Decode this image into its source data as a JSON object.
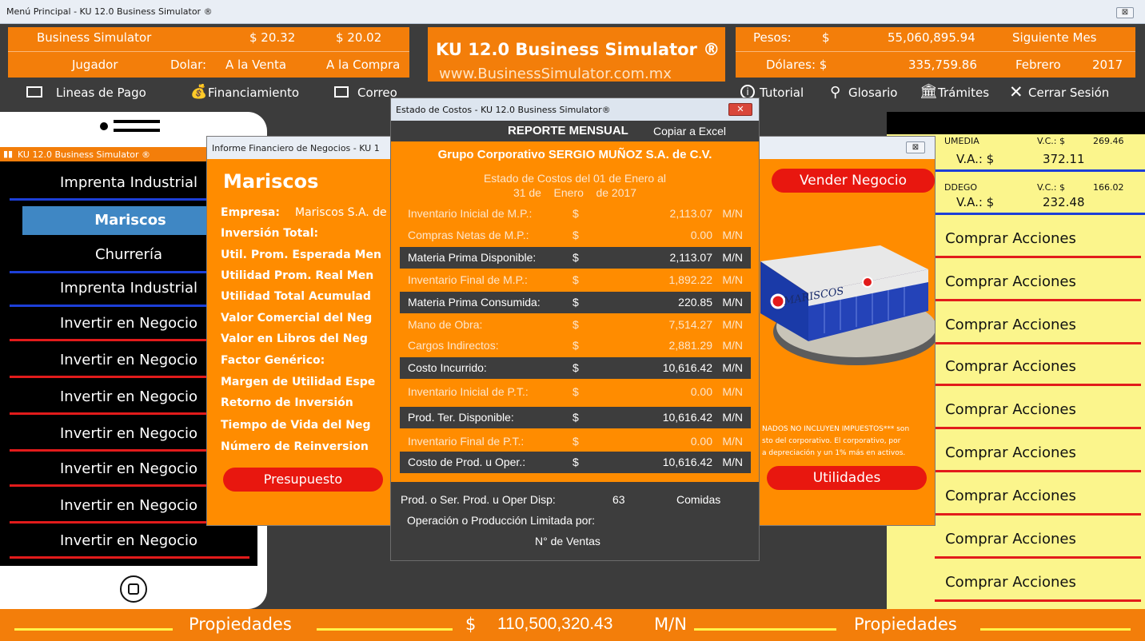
{
  "window": {
    "title": "Menú Principal - KU 12.0 Business Simulator ®",
    "close": "⊠"
  },
  "header": {
    "business_simulator": "Business Simulator",
    "price1": "$ 20.32",
    "price2": "$ 20.02",
    "jugador": "Jugador",
    "dolar": "Dolar:",
    "a_la_venta": "A la Venta",
    "a_la_compra": "A la Compra",
    "brand_title": "KU 12.0 Business Simulator ®",
    "brand_url": "www.BusinessSimulator.com.mx",
    "pesos_label": "Pesos:",
    "pesos_cur": "$",
    "pesos_value": "55,060,895.94",
    "siguiente_mes": "Siguiente Mes",
    "dolares_label": "Dólares: $",
    "dolares_value": "335,759.86",
    "month": "Febrero",
    "year": "2017"
  },
  "toolbar": {
    "lineas": "Lineas de Pago",
    "financiamiento": "Financiamiento",
    "correo": "Correo",
    "tutorial": "Tutorial",
    "glosario": "Glosario",
    "tramites": "Trámites",
    "cerrar": "Cerrar Sesión"
  },
  "phone": {
    "status": "KU 12.0 Business Simulator ®",
    "items": [
      "Imprenta Industrial",
      "Mariscos",
      "Churrería",
      "Imprenta Industrial",
      "Invertir en Negocio",
      "Invertir en Negocio",
      "Invertir en Negocio",
      "Invertir en Negocio",
      "Invertir en Negocio",
      "Invertir en Negocio",
      "Invertir en Negocio"
    ]
  },
  "right": {
    "r1_name": "UMEDIA",
    "r1_vc_label": "V.C.: $",
    "r1_vc": "269.46",
    "r1_va_label": "V.A.: $",
    "r1_va": "372.11",
    "r2_name": "DDEGO",
    "r2_vc_label": "V.C.: $",
    "r2_vc": "166.02",
    "r2_va_label": "V.A.: $",
    "r2_va": "232.48",
    "buy": "Comprar Acciones"
  },
  "informe": {
    "title": "Informe Financiero de Negocios - KU 1",
    "heading": "Mariscos",
    "empresa_label": "Empresa:",
    "empresa_value": "Mariscos S.A. de",
    "labels": [
      "Inversión Total:",
      "Util. Prom. Esperada Men",
      "Utilidad Prom. Real Men",
      "Utilidad Total Acumulad",
      "Valor Comercial del Neg",
      "Valor en Libros del Neg",
      "Factor Genérico:",
      "Margen de Utilidad Espe",
      "Retorno de Inversión",
      "Tiempo de Vida del Neg",
      "Número de Reinversion"
    ],
    "presupuesto": "Presupuesto",
    "vender": "Vender Negocio",
    "utilidades": "Utilidades",
    "building_sign": "MARISCOS",
    "note1": "NADOS NO INCLUYEN IMPUESTOS*** son",
    "note2": "sto del corporativo. El corporativo, por",
    "note3": "a depreciación y un 1% más en activos.",
    "close": "⊠"
  },
  "costos": {
    "title": "Estado de Costos - KU 12.0 Business Simulator®",
    "report": "REPORTE MENSUAL",
    "copy": "Copiar a Excel",
    "company": "Grupo Corporativo SERGIO MUÑOZ S.A. de C.V.",
    "period1": "Estado de Costos del 01 de Enero al",
    "period2": "31 de    Enero    de 2017",
    "rows": [
      {
        "label": "Inventario Inicial de M.P.:",
        "cur": "$",
        "value": "2,113.07",
        "unit": "M/N"
      },
      {
        "label": "Compras Netas de M.P.:",
        "cur": "$",
        "value": "0.00",
        "unit": "M/N"
      },
      {
        "label": "Materia Prima Disponible:",
        "cur": "$",
        "value": "2,113.07",
        "unit": "M/N"
      },
      {
        "label": "Inventario Final de M.P.:",
        "cur": "$",
        "value": "1,892.22",
        "unit": "M/N"
      },
      {
        "label": "Materia Prima Consumida:",
        "cur": "$",
        "value": "220.85",
        "unit": "M/N"
      },
      {
        "label": "Mano de Obra:",
        "cur": "$",
        "value": "7,514.27",
        "unit": "M/N"
      },
      {
        "label": "Cargos Indirectos:",
        "cur": "$",
        "value": "2,881.29",
        "unit": "M/N"
      },
      {
        "label": "Costo Incurrido:",
        "cur": "$",
        "value": "10,616.42",
        "unit": "M/N"
      },
      {
        "label": "Inventario Inicial de P.T.:",
        "cur": "$",
        "value": "0.00",
        "unit": "M/N"
      },
      {
        "label": "Prod. Ter. Disponible:",
        "cur": "$",
        "value": "10,616.42",
        "unit": "M/N"
      },
      {
        "label": "Inventario Final de P.T.:",
        "cur": "$",
        "value": "0.00",
        "unit": "M/N"
      },
      {
        "label": "Costo de Prod. u Oper.:",
        "cur": "$",
        "value": "10,616.42",
        "unit": "M/N"
      }
    ],
    "prod_label": "Prod. o Ser. Prod. u Oper Disp:",
    "prod_value": "63",
    "prod_unit": "Comidas",
    "limit_label": "Operación o Producción Limitada por:",
    "limit_value": "N° de Ventas",
    "close": "✕"
  },
  "bottom": {
    "left": "Propiedades",
    "cur": "$",
    "amount": "110,500,320.43",
    "unit": "M/N",
    "right": "Propiedades"
  },
  "colors": {
    "orange": "#f37e0a",
    "dark": "#3c3c3c",
    "red": "#e21b1b",
    "yellow": "#fbf58c",
    "blue": "#3f87c4"
  }
}
